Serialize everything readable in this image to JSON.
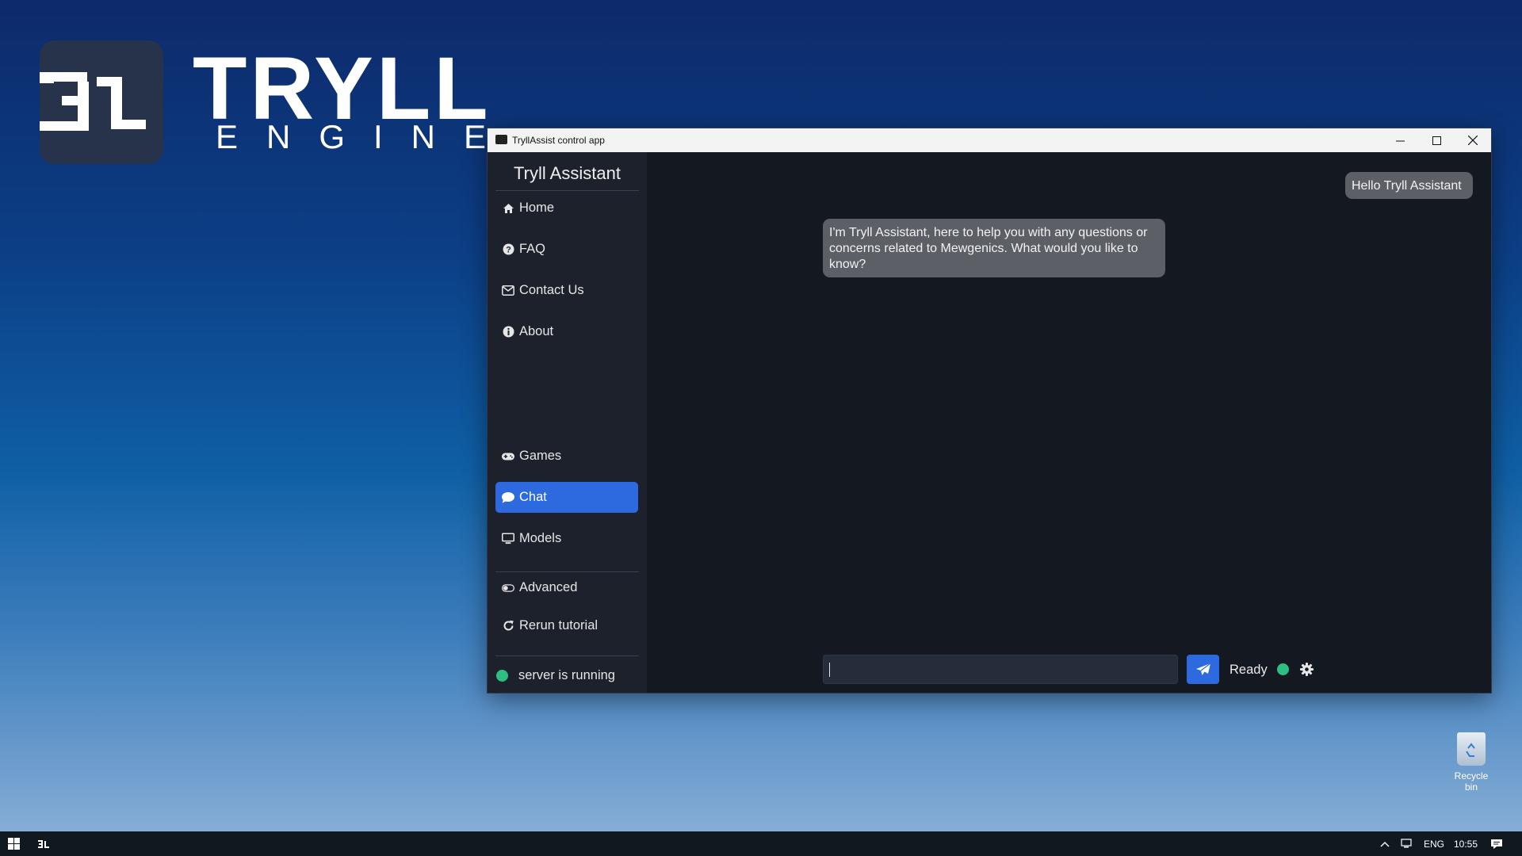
{
  "desktop": {
    "logo_word": "TRYLL",
    "logo_sub": "ENGINE",
    "recycle_bin_label": "Recycle bin"
  },
  "window": {
    "title": "TryllAssist control app",
    "controls": {
      "minimize_icon": "minimize-icon",
      "maximize_icon": "maximize-icon",
      "close_icon": "close-icon"
    }
  },
  "sidebar": {
    "title": "Tryll Assistant",
    "top_items": [
      {
        "label": "Home",
        "icon": "home-icon"
      },
      {
        "label": "FAQ",
        "icon": "question-circle-icon"
      },
      {
        "label": "Contact Us",
        "icon": "envelope-icon"
      },
      {
        "label": "About",
        "icon": "info-circle-icon"
      }
    ],
    "bottom_items": [
      {
        "label": "Games",
        "icon": "gamepad-icon"
      },
      {
        "label": "Chat",
        "icon": "chat-bubble-icon",
        "active": true
      },
      {
        "label": "Models",
        "icon": "monitor-icon"
      }
    ],
    "extra_items": [
      {
        "label": "Advanced",
        "icon": "toggle-icon"
      },
      {
        "label": "Rerun tutorial",
        "icon": "redo-icon"
      }
    ],
    "server_status": "server is running"
  },
  "chat": {
    "messages": [
      {
        "role": "user",
        "text": "Hello Tryll Assistant"
      },
      {
        "role": "assistant",
        "text": "I'm Tryll Assistant, here to help you with any questions or concerns related to Mewgenics. What would you like to know?"
      }
    ],
    "input_value": "",
    "status_text": "Ready"
  },
  "taskbar": {
    "language": "ENG",
    "time": "10:55"
  },
  "colors": {
    "accent": "#2d6ae0",
    "status_green": "#2fbe82",
    "sidebar_bg": "#1c212b",
    "chat_bg": "#141820"
  }
}
